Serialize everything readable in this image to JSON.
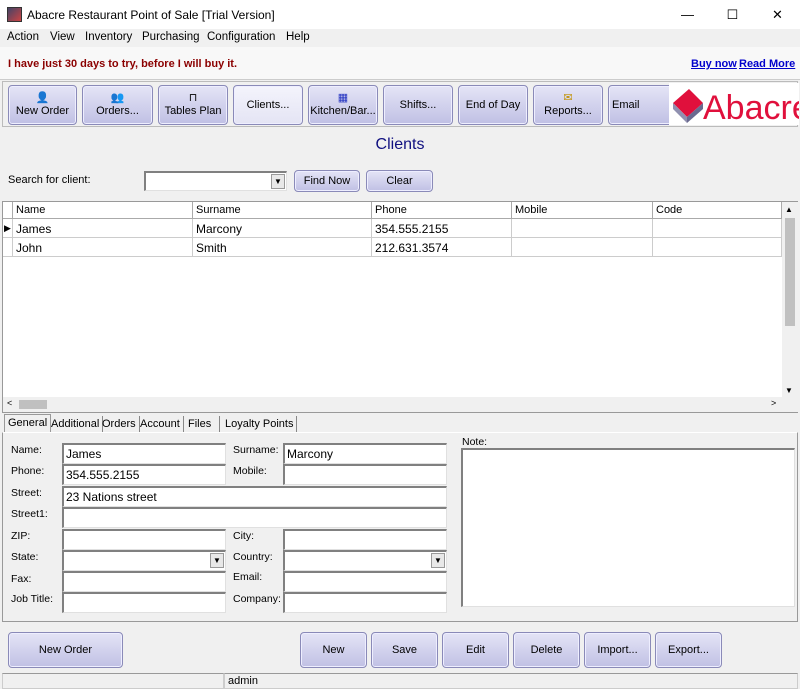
{
  "window": {
    "title": "Abacre Restaurant Point of Sale [Trial Version]",
    "minimize": "—",
    "maximize": "☐",
    "close": "✕"
  },
  "menu": [
    "Action",
    "View",
    "Inventory",
    "Purchasing",
    "Configuration",
    "Help"
  ],
  "trial": {
    "message": "I have just 30 days to try, before I will buy it.",
    "buy_now": "Buy now",
    "read_more": "Read More"
  },
  "toolbar": [
    {
      "label": "New Order",
      "icon": "user-add-icon",
      "glyph": "👤"
    },
    {
      "label": "Orders...",
      "icon": "users-icon",
      "glyph": "👥"
    },
    {
      "label": "Tables Plan",
      "icon": "table-icon",
      "glyph": "⊓"
    },
    {
      "label": "Clients...",
      "icon": "",
      "glyph": ""
    },
    {
      "label": "Kitchen/Bar...",
      "icon": "kitchen-icon",
      "glyph": "▦"
    },
    {
      "label": "Shifts...",
      "icon": "",
      "glyph": ""
    },
    {
      "label": "End of Day",
      "icon": "",
      "glyph": ""
    },
    {
      "label": "Reports...",
      "icon": "reports-icon",
      "glyph": "✉"
    },
    {
      "label": "Email Sender",
      "icon": "",
      "glyph": ""
    }
  ],
  "logo": {
    "text": "Abacre",
    "color": "#e0103c"
  },
  "page_title": "Clients",
  "search": {
    "label": "Search for client:",
    "value": "",
    "find_now": "Find Now",
    "clear": "Clear"
  },
  "grid": {
    "columns": [
      "Name",
      "Surname",
      "Phone",
      "Mobile",
      "Code"
    ],
    "rows": [
      [
        "James",
        "Marcony",
        "354.555.2155",
        "",
        ""
      ],
      [
        "John",
        "Smith",
        "212.631.3574",
        "",
        ""
      ]
    ],
    "selected_row": 0
  },
  "tabs": [
    "General",
    "Additional",
    "Orders",
    "Account",
    "Files",
    "Loyalty Points"
  ],
  "form": {
    "name": {
      "label": "Name:",
      "value": "James"
    },
    "surname": {
      "label": "Surname:",
      "value": "Marcony"
    },
    "phone": {
      "label": "Phone:",
      "value": "354.555.2155"
    },
    "mobile": {
      "label": "Mobile:",
      "value": ""
    },
    "street": {
      "label": "Street:",
      "value": "23 Nations street"
    },
    "street1": {
      "label": "Street1:",
      "value": ""
    },
    "zip": {
      "label": "ZIP:",
      "value": ""
    },
    "city": {
      "label": "City:",
      "value": ""
    },
    "state": {
      "label": "State:",
      "value": ""
    },
    "country": {
      "label": "Country:",
      "value": ""
    },
    "fax": {
      "label": "Fax:",
      "value": ""
    },
    "email": {
      "label": "Email:",
      "value": ""
    },
    "job_title": {
      "label": "Job Title:",
      "value": ""
    },
    "company": {
      "label": "Company:",
      "value": ""
    },
    "note": {
      "label": "Note:",
      "value": ""
    }
  },
  "bottom": {
    "new_order": "New Order",
    "new": "New",
    "save": "Save",
    "edit": "Edit",
    "delete": "Delete",
    "import": "Import...",
    "export": "Export..."
  },
  "status": {
    "panel1": "",
    "user": "admin"
  },
  "colors": {
    "button": "#c8c8ea",
    "title": "#101080",
    "trial": "#8b0000",
    "link": "#0000cc"
  }
}
